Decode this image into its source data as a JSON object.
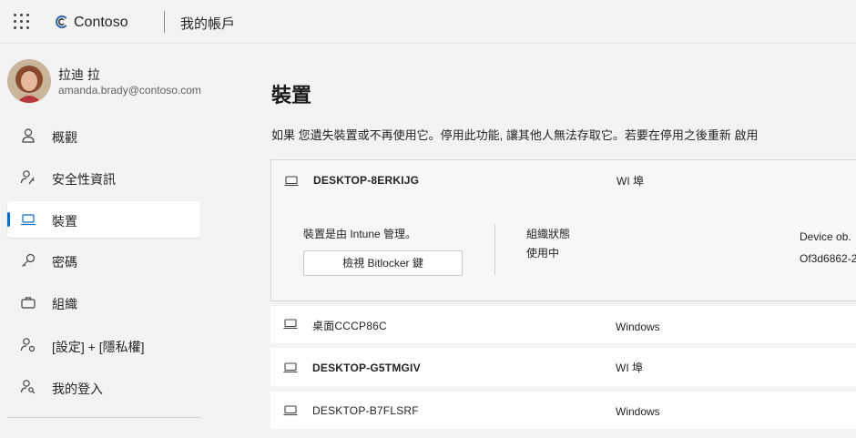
{
  "header": {
    "brand": "Contoso",
    "app_title": "我的帳戶",
    "icons": {
      "launcher": "app-launcher-waffle-icon",
      "logo": "contoso-logo-icon"
    }
  },
  "user": {
    "name": "拉迪 拉",
    "email": "amanda.brady@contoso.com"
  },
  "nav": {
    "items": [
      {
        "label": "概觀",
        "icon": "person-icon"
      },
      {
        "label": "安全性資訊",
        "icon": "person-key-icon"
      },
      {
        "label": "裝置",
        "icon": "laptop-icon",
        "active": true
      },
      {
        "label": "密碼",
        "icon": "key-icon"
      },
      {
        "label": "組織",
        "icon": "briefcase-icon"
      },
      {
        "label": "[設定] + [隱私權]",
        "icon": "person-settings-icon"
      },
      {
        "label": "我的登入",
        "icon": "person-lock-icon"
      }
    ]
  },
  "main": {
    "title": "裝置",
    "description": "如果 您遺失裝置或不再使用它。停用此功能, 讓其他人無法存取它。若要在停用之後重新 啟用",
    "devices": [
      {
        "name": "DESKTOP-8ERKIJG",
        "os": "WI 埠",
        "expanded": true,
        "details": {
          "intune_text": "裝置是由 Intune 管理。",
          "bitlocker_button": "檢視 Bitlocker 鍵",
          "org_state_label": "組織狀態",
          "org_state_value": "使用中",
          "device_object_label": "Device ob.",
          "device_object_value": "Of3d6862-2"
        }
      },
      {
        "name": "桌面CCCP86C",
        "os": "Windows"
      },
      {
        "name": "DESKTOP-G5TMGIV",
        "os": "WI 埠"
      },
      {
        "name": "DESKTOP-B7FLSRF",
        "os": "Windows"
      }
    ]
  },
  "colors": {
    "accent": "#0f6cbd",
    "background": "#f3f3f3",
    "card": "#ffffff"
  }
}
